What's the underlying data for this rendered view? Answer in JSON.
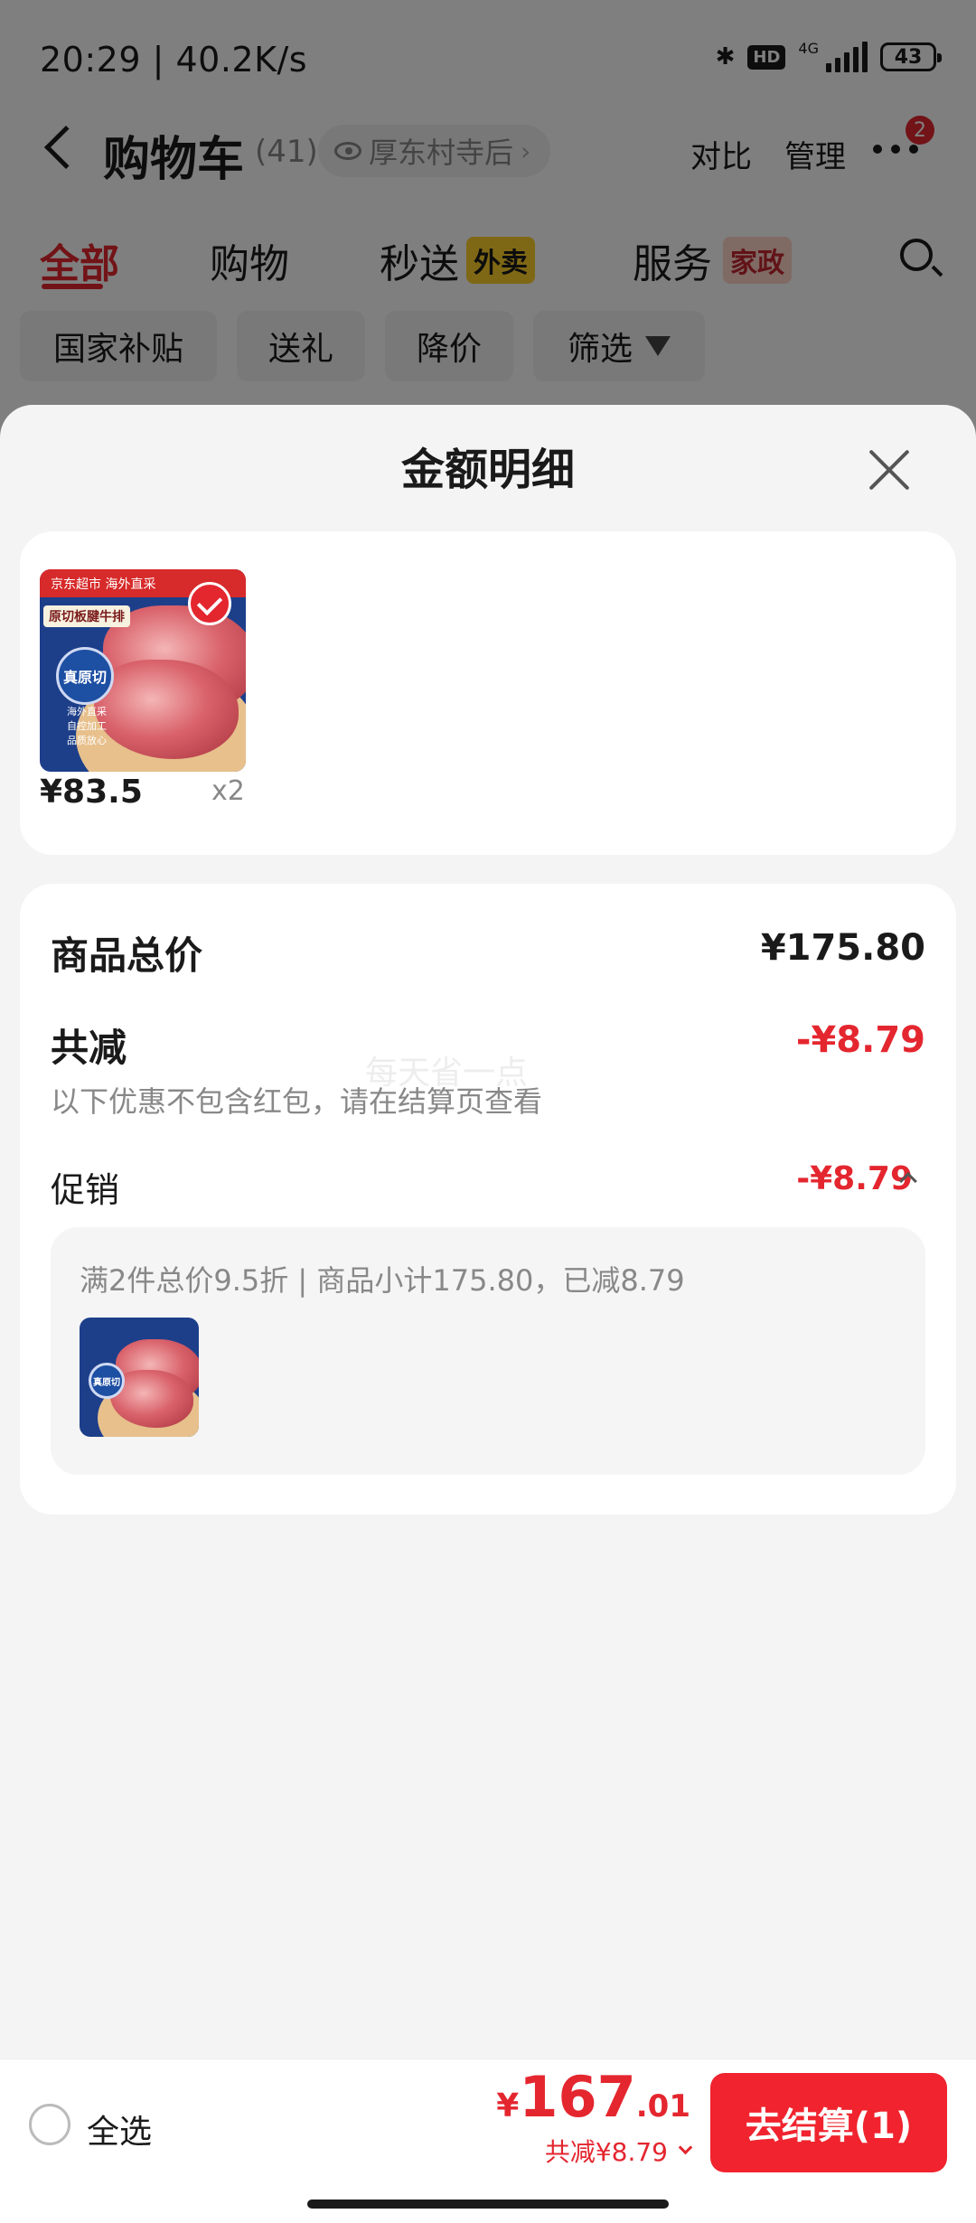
{
  "status_bar": {
    "time": "20:29 | 40.2K/s",
    "hd": "HD",
    "network": "4G",
    "battery": "43"
  },
  "nav": {
    "title": "购物车",
    "count": "(41)",
    "location": "厚东村寺后",
    "location_chevron": "›",
    "compare": "对比",
    "manage": "管理",
    "badge": "2"
  },
  "tabs": [
    {
      "label": "全部",
      "active": true
    },
    {
      "label": "购物",
      "active": false
    },
    {
      "label": "秒送",
      "tag": "外卖"
    },
    {
      "label": "服务",
      "tag": "家政"
    }
  ],
  "chips": [
    "国家补贴",
    "送礼",
    "降价",
    "筛选"
  ],
  "sheet": {
    "title": "金额明细",
    "item": {
      "price": "¥83.5",
      "qty": "x2",
      "thumb_banner": "京东超市 海外直采",
      "thumb_label": "原切板腱牛排",
      "thumb_seal": "真原切",
      "thumb_note": [
        "海外直采",
        "自控加工",
        "品质放心"
      ]
    },
    "summary": {
      "total_label": "商品总价",
      "total_value": "¥175.80",
      "discount_label": "共减",
      "discount_value": "-¥8.79",
      "discount_note": "以下优惠不包含红包，请在结算页查看",
      "watermark": "每天省一点",
      "promo_label": "促销",
      "promo_value": "-¥8.79",
      "promo_desc": "满2件总价9.5折 | 商品小计175.80，已减8.79"
    }
  },
  "bottom_bar": {
    "select_all": "全选",
    "total_yen": "¥",
    "total_int": "167",
    "total_dec": ".01",
    "total_discount": "共减¥8.79",
    "checkout": "去结算(1)"
  },
  "colors": {
    "accent": "#e4262f",
    "checkout": "#f0232e",
    "sheet_bg": "#f4f4f4"
  },
  "icons": [
    "bluetooth-icon",
    "signal-icon",
    "battery-icon",
    "back-icon",
    "eye-icon",
    "more-icon",
    "search-icon",
    "filter-icon",
    "close-icon",
    "check-icon",
    "chevron-up-icon",
    "chevron-down-icon",
    "radio-icon"
  ]
}
